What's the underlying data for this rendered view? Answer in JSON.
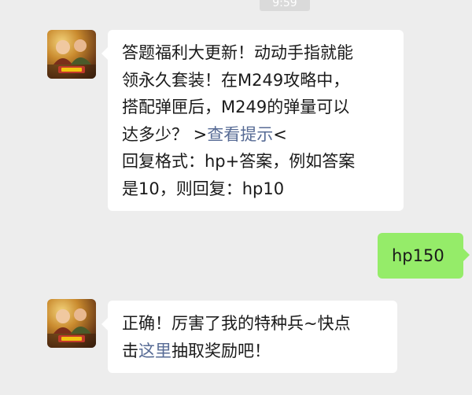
{
  "timestamp": "9:59",
  "messages": [
    {
      "sender": "official-account",
      "lines": [
        "答题福利大更新！动动手指就能",
        "领永久套装！在M249攻略中，",
        "搭配弹匣后，M249的弹量可以"
      ],
      "line4_prefix": "达多少？ >",
      "line4_link": "查看提示",
      "line4_suffix": "<",
      "line5": "回复格式：hp+答案，例如答案",
      "line6": "是10，则回复：hp10"
    },
    {
      "sender": "me",
      "text": "hp150"
    },
    {
      "sender": "official-account",
      "line1": "正确！厉害了我的特种兵~快点",
      "line2_prefix": "击",
      "line2_link": "这里",
      "line2_suffix": "抽取奖励吧！"
    }
  ],
  "colors": {
    "background": "#ededed",
    "incoming_bubble": "#ffffff",
    "outgoing_bubble": "#95ec69",
    "link": "#576b95"
  },
  "icons": {
    "avatar": "game-character-avatar"
  }
}
